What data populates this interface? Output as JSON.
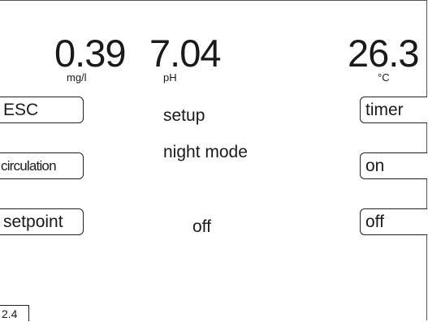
{
  "readings": {
    "oxygen": {
      "value": "0.39",
      "unit": "mg/l"
    },
    "ph": {
      "value": "7.04",
      "unit": "pH"
    },
    "temperature": {
      "value": "26.3",
      "unit": "°C"
    }
  },
  "buttons": {
    "esc": "ESC",
    "circulation": "circulation",
    "setpoint": "setpoint",
    "timer": "timer",
    "on": "on",
    "off": "off"
  },
  "labels": {
    "setup": "setup",
    "night_mode": "night mode",
    "setpoint_state": "off"
  },
  "page_indicator": "2.4"
}
